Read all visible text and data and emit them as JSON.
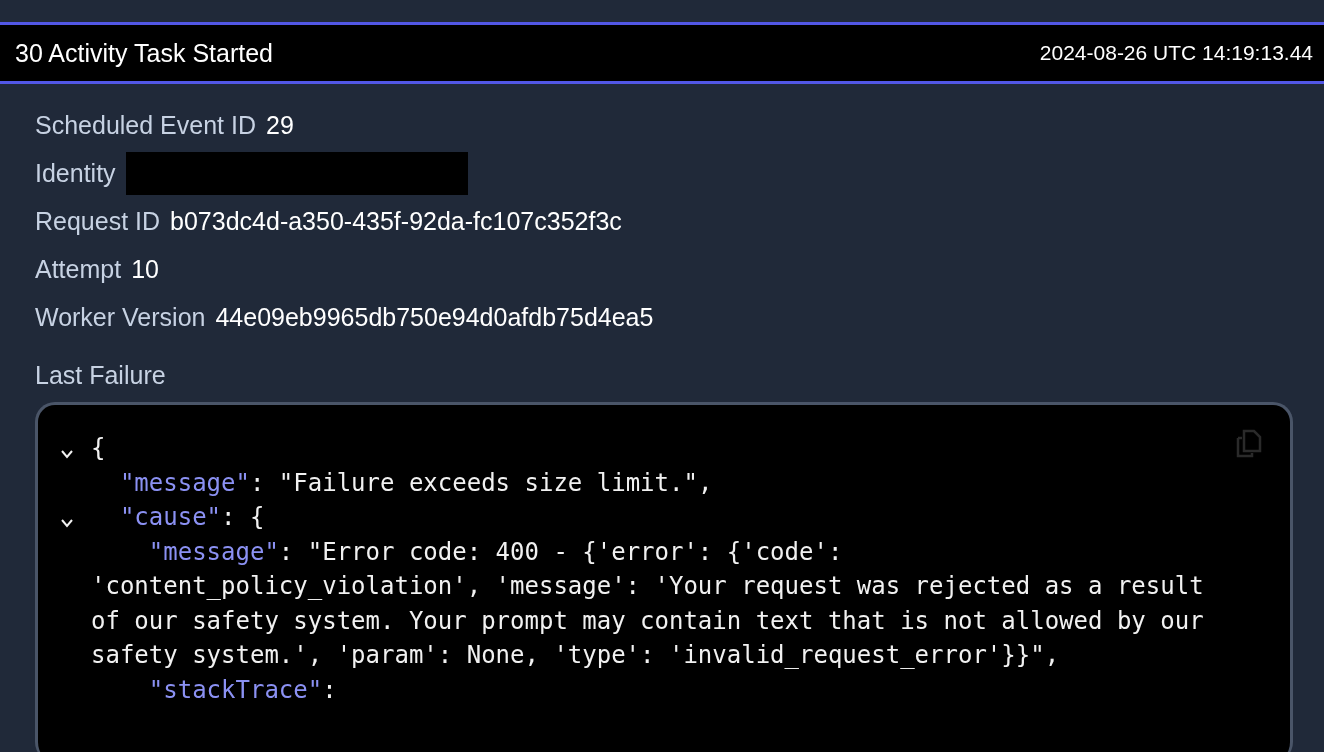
{
  "event_header": {
    "title": "30 Activity Task Started",
    "timestamp": "2024-08-26 UTC 14:19:13.44"
  },
  "details": [
    {
      "kind": "value",
      "label": "Scheduled Event ID",
      "value": "29"
    },
    {
      "kind": "redacted",
      "label": "Identity"
    },
    {
      "kind": "value",
      "label": "Request ID",
      "value": "b073dc4d-a350-435f-92da-fc107c352f3c"
    },
    {
      "kind": "value",
      "label": "Attempt",
      "value": "10"
    },
    {
      "kind": "value",
      "label": "Worker Version",
      "value": "44e09eb9965db750e94d0afdb75d4ea5"
    }
  ],
  "last_failure": {
    "title": "Last Failure",
    "lines": [
      {
        "expanded": true,
        "parts": [
          {
            "kind": "punct",
            "text": "{"
          }
        ]
      },
      {
        "parts": [
          {
            "kind": "key",
            "text": "  \"message\""
          },
          {
            "kind": "punct",
            "text": ": \"Failure exceeds size limit.\","
          }
        ]
      },
      {
        "expanded": true,
        "parts": [
          {
            "kind": "key",
            "text": "  \"cause\""
          },
          {
            "kind": "punct",
            "text": ": {"
          }
        ]
      },
      {
        "parts": [
          {
            "kind": "key",
            "text": "    \"message\""
          },
          {
            "kind": "punct",
            "text": ": \"Error code: 400 - {'error': {'code':"
          }
        ]
      },
      {
        "parts": [
          {
            "kind": "punct",
            "text": "'content_policy_violation', 'message': 'Your request was rejected as a result"
          }
        ]
      },
      {
        "parts": [
          {
            "kind": "punct",
            "text": "of our safety system. Your prompt may contain text that is not allowed by our"
          }
        ]
      },
      {
        "parts": [
          {
            "kind": "punct",
            "text": "safety system.', 'param': None, 'type': 'invalid_request_error'}}\","
          }
        ]
      },
      {
        "parts": [
          {
            "kind": "key",
            "text": "    \"stackTrace\""
          },
          {
            "kind": "punct",
            "text": ":"
          }
        ]
      }
    ]
  }
}
